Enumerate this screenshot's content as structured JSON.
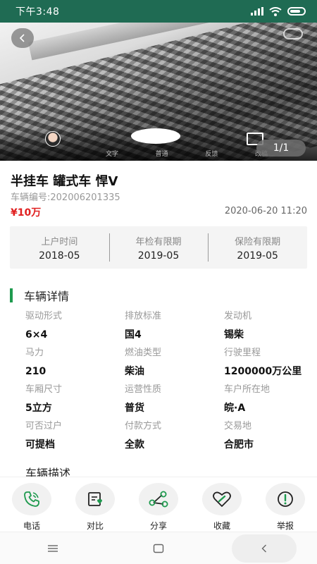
{
  "status_bar": {
    "time": "下午3:48",
    "icons": [
      "signal-icon",
      "wifi-icon",
      "battery-icon"
    ]
  },
  "gallery": {
    "counter": "1/1",
    "camera_modes": [
      "文字",
      "普通",
      "反馈",
      "改稿"
    ]
  },
  "vehicle": {
    "title": "半挂车 罐式车 悍V",
    "number": "车辆编号:202006201335",
    "price": "¥10万",
    "date": "2020-06-20 11:20"
  },
  "dates": [
    {
      "label": "上户时间",
      "value": "2018-05"
    },
    {
      "label": "年检有限期",
      "value": "2019-05"
    },
    {
      "label": "保险有限期",
      "value": "2019-05"
    }
  ],
  "details_section": {
    "title": "车辆详情",
    "items": [
      {
        "label": "驱动形式",
        "value": "6×4"
      },
      {
        "label": "排放标准",
        "value": "国4"
      },
      {
        "label": "发动机",
        "value": "锡柴"
      },
      {
        "label": "马力",
        "value": "210"
      },
      {
        "label": "燃油类型",
        "value": "柴油"
      },
      {
        "label": "行驶里程",
        "value": "1200000万公里"
      },
      {
        "label": "车厢尺寸",
        "value": "5立方"
      },
      {
        "label": "运营性质",
        "value": "普货"
      },
      {
        "label": "车户所在地",
        "value": "皖·A"
      },
      {
        "label": "可否过户",
        "value": "可提档"
      },
      {
        "label": "付款方式",
        "value": "全款"
      },
      {
        "label": "交易地",
        "value": "合肥市"
      }
    ]
  },
  "description_section": {
    "title": "车辆描述"
  },
  "actions": [
    {
      "label": "电话",
      "icon": "phone-icon"
    },
    {
      "label": "对比",
      "icon": "compare-icon"
    },
    {
      "label": "分享",
      "icon": "share-icon"
    },
    {
      "label": "收藏",
      "icon": "heart-icon"
    },
    {
      "label": "举报",
      "icon": "report-icon"
    }
  ],
  "colors": {
    "status_bar": "#1f6b53",
    "accent_green": "#1e9a4e",
    "price_red": "#e02020"
  },
  "nav": [
    "menu-icon",
    "home-icon",
    "back-icon"
  ]
}
